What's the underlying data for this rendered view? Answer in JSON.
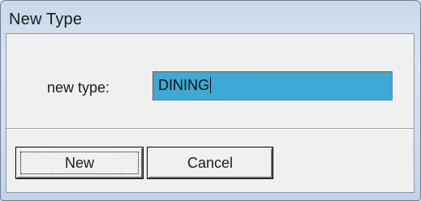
{
  "window": {
    "title": "New Type"
  },
  "form": {
    "label": "new type:",
    "value": "DINING"
  },
  "buttons": {
    "new_label": "New",
    "cancel_label": "Cancel"
  }
}
